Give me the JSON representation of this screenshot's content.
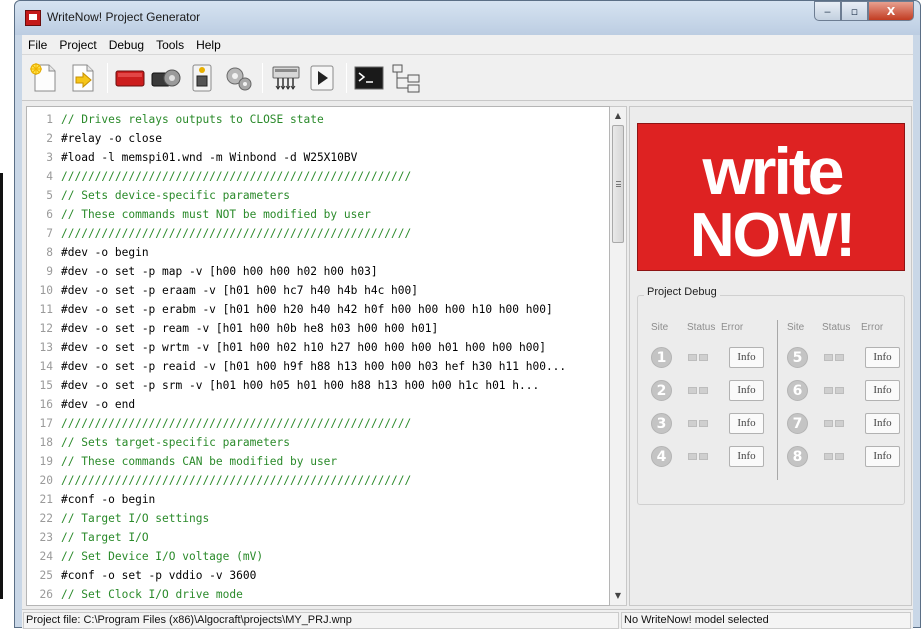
{
  "window": {
    "title": "WriteNow! Project Generator",
    "controls": {
      "minimize": "‒",
      "maximize": "▫",
      "close": "X"
    }
  },
  "menu": [
    "File",
    "Project",
    "Debug",
    "Tools",
    "Help"
  ],
  "toolbar": [
    {
      "icon": "new-project-icon"
    },
    {
      "icon": "open-project-icon"
    },
    {
      "icon": "device-red-icon"
    },
    {
      "icon": "device-gears-icon"
    },
    {
      "icon": "chip-config-icon"
    },
    {
      "icon": "gear-settings-icon"
    },
    {
      "icon": "programmer-icon"
    },
    {
      "icon": "run-icon"
    },
    {
      "icon": "terminal-icon"
    },
    {
      "icon": "tree-structure-icon"
    }
  ],
  "editor": {
    "lines": [
      {
        "n": "1",
        "text": "// Drives relays outputs to CLOSE state",
        "comment": true
      },
      {
        "n": "2",
        "text": "#relay -o close",
        "comment": false
      },
      {
        "n": "3",
        "text": "#load -l memspi01.wnd -m Winbond -d W25X10BV",
        "comment": false
      },
      {
        "n": "4",
        "text": "////////////////////////////////////////////////////",
        "comment": true
      },
      {
        "n": "5",
        "text": "// Sets device-specific parameters",
        "comment": true
      },
      {
        "n": "6",
        "text": "// These commands must NOT be modified by user",
        "comment": true
      },
      {
        "n": "7",
        "text": "////////////////////////////////////////////////////",
        "comment": true
      },
      {
        "n": "8",
        "text": "#dev -o begin",
        "comment": false
      },
      {
        "n": "9",
        "text": "#dev -o set -p map -v [h00 h00 h00 h02 h00 h03]",
        "comment": false
      },
      {
        "n": "10",
        "text": "#dev -o set -p eraam -v [h01 h00 hc7 h40 h4b h4c h00]",
        "comment": false
      },
      {
        "n": "11",
        "text": "#dev -o set -p erabm -v [h01 h00 h20 h40 h42 h0f h00 h00 h00 h10 h00 h00]",
        "comment": false
      },
      {
        "n": "12",
        "text": "#dev -o set -p ream -v [h01 h00 h0b he8 h03 h00 h00 h01]",
        "comment": false
      },
      {
        "n": "13",
        "text": "#dev -o set -p wrtm -v [h01 h00 h02 h10 h27 h00 h00 h00 h01 h00 h00 h00]",
        "comment": false
      },
      {
        "n": "14",
        "text": "#dev -o set -p reaid -v [h01 h00 h9f h88 h13 h00 h00 h03 hef h30 h11 h00...",
        "comment": false
      },
      {
        "n": "15",
        "text": "#dev -o set -p srm -v [h01 h00 h05 h01 h00 h88 h13 h00 h00 h1c h01 h...",
        "comment": false
      },
      {
        "n": "16",
        "text": "#dev -o end",
        "comment": false
      },
      {
        "n": "17",
        "text": "////////////////////////////////////////////////////",
        "comment": true
      },
      {
        "n": "18",
        "text": "// Sets target-specific parameters",
        "comment": true
      },
      {
        "n": "19",
        "text": "// These commands CAN be modified by user",
        "comment": true
      },
      {
        "n": "20",
        "text": "////////////////////////////////////////////////////",
        "comment": true
      },
      {
        "n": "21",
        "text": "#conf -o begin",
        "comment": false
      },
      {
        "n": "22",
        "text": "// Target I/O settings",
        "comment": true
      },
      {
        "n": "23",
        "text": "// Target I/O",
        "comment": true
      },
      {
        "n": "24",
        "text": "// Set Device I/O voltage (mV)",
        "comment": true
      },
      {
        "n": "25",
        "text": "#conf -o set -p vddio -v 3600",
        "comment": false
      },
      {
        "n": "26",
        "text": "// Set Clock I/O drive mode",
        "comment": true
      }
    ]
  },
  "logo": {
    "top": "write",
    "bottom": "NOW!"
  },
  "project_debug": {
    "title": "Project Debug",
    "headers": {
      "site": "Site",
      "status": "Status",
      "error": "Error"
    },
    "sites": [
      {
        "num": "1",
        "info": "Info"
      },
      {
        "num": "2",
        "info": "Info"
      },
      {
        "num": "3",
        "info": "Info"
      },
      {
        "num": "4",
        "info": "Info"
      },
      {
        "num": "5",
        "info": "Info"
      },
      {
        "num": "6",
        "info": "Info"
      },
      {
        "num": "7",
        "info": "Info"
      },
      {
        "num": "8",
        "info": "Info"
      }
    ]
  },
  "statusbar": {
    "project_file": "Project file: C:\\Program Files (x86)\\Algocraft\\projects\\MY_PRJ.wnp",
    "model": "No WriteNow! model selected"
  },
  "colors": {
    "accent_red": "#de2222",
    "comment_green": "#2a8a2a"
  }
}
